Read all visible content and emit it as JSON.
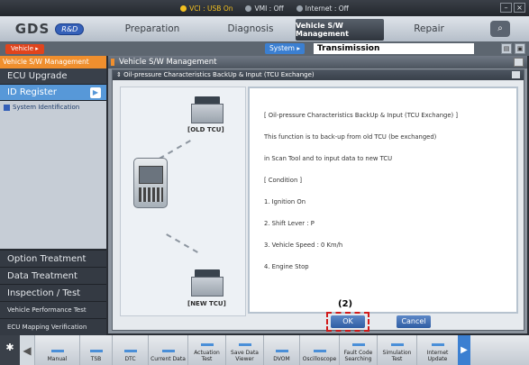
{
  "topbar": {
    "vci": "VCI : USB On",
    "vmi": "VMI : Off",
    "internet": "Internet : Off"
  },
  "logo": {
    "brand": "GDS",
    "badge": "R&D"
  },
  "nav": {
    "preparation": "Preparation",
    "diagnosis": "Diagnosis",
    "sw_management": "Vehicle S/W Management",
    "repair": "Repair"
  },
  "crumb": {
    "vehicle": "Vehicle",
    "system_label": "System",
    "system_value": "Transimission"
  },
  "sidebar": {
    "header": "Vehicle S/W Management",
    "ecu_upgrade": "ECU Upgrade",
    "id_register": "ID Register",
    "system_identification": "System Identification",
    "bottom": [
      "Option Treatment",
      "Data Treatment",
      "Inspection / Test",
      "Vehicle Performance Test",
      "ECU Mapping Verification"
    ]
  },
  "window": {
    "title": "Vehicle S/W Management"
  },
  "dialog": {
    "title": "Oil-pressure Characteristics BackUp & Input (TCU Exchange)",
    "old_tcu": "[OLD TCU]",
    "new_tcu": "[NEW TCU]",
    "content": {
      "heading": "[ Oil-pressure Characteristics BackUp & Input (TCU Exchange) ]",
      "line1": "This function is to back-up from old TCU (be exchanged)",
      "line2": "in Scan Tool and to input data to new TCU",
      "condition": "[ Condition ]",
      "c1": "1. Ignition On",
      "c2": "2. Shift Lever : P",
      "c3": "3. Vehicle Speed : 0 Km/h",
      "c4": "4. Engine Stop"
    },
    "ok": "OK",
    "cancel": "Cancel",
    "marker": "(2)"
  },
  "toolbar": [
    {
      "label": "Manual"
    },
    {
      "label": "TSB"
    },
    {
      "label": "DTC"
    },
    {
      "label": "Current Data"
    },
    {
      "label": "Actuation Test"
    },
    {
      "label": "Save Data Viewer"
    },
    {
      "label": "DVOM"
    },
    {
      "label": "Oscilloscope"
    },
    {
      "label": "Fault Code Searching"
    },
    {
      "label": "Simulation Test"
    },
    {
      "label": "Internet Update"
    }
  ],
  "colors": {
    "accent_orange": "#f08f2e",
    "accent_blue": "#3b7fd1",
    "highlight_red": "#d11a1a"
  }
}
